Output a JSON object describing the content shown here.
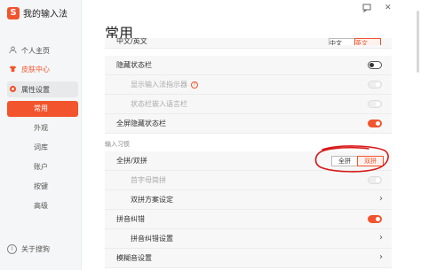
{
  "app": {
    "logo": "S",
    "title": "我的输入法"
  },
  "window_controls": {
    "feedback_icon": "feedback-icon",
    "close_glyph": "✕"
  },
  "sidebar": {
    "items": [
      {
        "label": "个人主页",
        "icon": "person-icon"
      },
      {
        "label": "皮肤中心",
        "icon": "skin-icon"
      },
      {
        "label": "属性设置",
        "icon": "settings-icon"
      }
    ],
    "sub_items": [
      "常用",
      "外观",
      "词库",
      "账户",
      "按键",
      "高级"
    ],
    "active_sub": "常用",
    "bottom": {
      "label": "关于搜狗",
      "icon": "info-icon"
    }
  },
  "main": {
    "title": "常用",
    "top_partial_label": "中文/英文",
    "top_partial_options": [
      "中文",
      "英文"
    ],
    "rows": [
      {
        "label": "隐藏状态栏",
        "toggle": "off"
      },
      {
        "label": "显示输入法指示器",
        "toggle": "disabled",
        "help": "?"
      },
      {
        "label": "状态栏嵌入语言栏",
        "toggle": "disabled"
      },
      {
        "label": "全屏隐藏状态栏",
        "toggle": "on"
      }
    ],
    "section_input_habit": "输入习惯",
    "habit_rows": [
      {
        "label": "全拼/双拼",
        "options": [
          "全拼",
          "双拼"
        ],
        "selected": "双拼"
      },
      {
        "label": "首字母简拼",
        "toggle": "disabled"
      },
      {
        "label": "双拼方案设定",
        "chevron": "›"
      },
      {
        "label": "拼音纠错",
        "toggle": "on"
      },
      {
        "label": "拼音纠错设置",
        "chevron": "›"
      },
      {
        "label": "模糊音设置",
        "chevron": "›"
      }
    ]
  },
  "colors": {
    "accent": "#f2542d",
    "sidebar_bg": "#f5f6f7",
    "row_bg": "#f7f7f8",
    "annotation": "#d81818"
  }
}
